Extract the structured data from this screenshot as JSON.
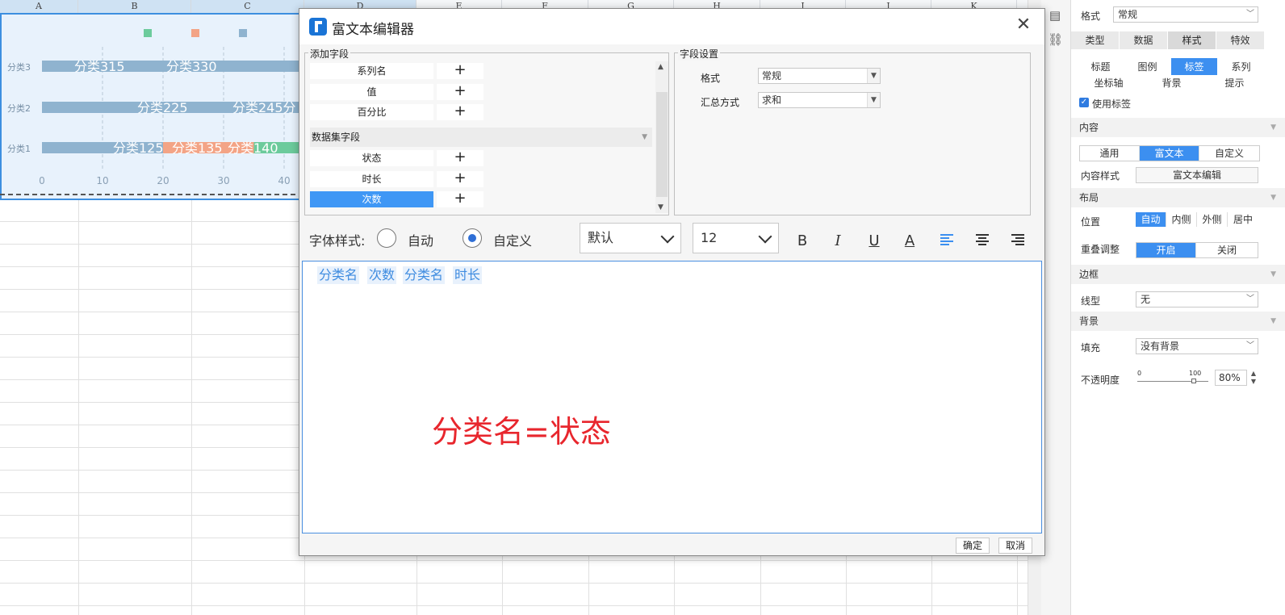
{
  "sheet": {
    "columns": [
      "A",
      "B",
      "C",
      "D",
      "E",
      "F",
      "G",
      "H",
      "I",
      "J",
      "K"
    ]
  },
  "chart_data": {
    "type": "bar",
    "orientation": "horizontal",
    "stacked": true,
    "categories": [
      "分类3",
      "分类2",
      "分类1"
    ],
    "series": [
      {
        "values": [
          50,
          60,
          20
        ],
        "color": "#8fb3cf"
      },
      {
        "values": [
          0,
          0,
          15
        ],
        "color": "#f3a486"
      },
      {
        "values": [
          0,
          0,
          15
        ],
        "color": "#6ccb9c"
      }
    ],
    "data_labels": [
      {
        "category": "分类3",
        "texts": [
          "分类315",
          "分类330"
        ]
      },
      {
        "category": "分类2",
        "texts": [
          "分类225",
          "分类245分"
        ]
      },
      {
        "category": "分类1",
        "texts": [
          "分类125",
          "分类135",
          "分类140"
        ]
      }
    ],
    "x_ticks": [
      "0",
      "10",
      "20",
      "30",
      "40"
    ],
    "xlim": [
      0,
      40
    ],
    "legend_position": "top",
    "legend_colors": [
      "#6ccb9c",
      "#f3a486",
      "#8fb3cf"
    ],
    "grid": true
  },
  "dialog": {
    "title": "富文本编辑器",
    "close_symbol": "✕",
    "add_fields_legend": "添加字段",
    "fields": [
      {
        "label": "系列名",
        "add": "+"
      },
      {
        "label": "值",
        "add": "+"
      },
      {
        "label": "百分比",
        "add": "+"
      }
    ],
    "dataset_header": "数据集字段",
    "dataset_fields": [
      {
        "label": "状态",
        "add": "+"
      },
      {
        "label": "时长",
        "add": "+"
      },
      {
        "label": "次数",
        "add": "+",
        "selected": true
      }
    ],
    "field_settings_legend": "字段设置",
    "settings": {
      "format_label": "格式",
      "format_value": "常规",
      "summary_label": "汇总方式",
      "summary_value": "求和"
    },
    "toolbar": {
      "font_style_label": "字体样式:",
      "radio_auto": "自动",
      "radio_custom": "自定义",
      "font_family": "默认",
      "font_size": "12",
      "bold": "B",
      "italic": "I",
      "underline": "U",
      "font_color": "A"
    },
    "editor": {
      "tags": [
        "分类名",
        "次数",
        "分类名",
        "时长"
      ],
      "red_note": "分类名=状态"
    },
    "ok": "确定",
    "cancel": "取消"
  },
  "panel": {
    "format_label": "格式",
    "format_value": "常规",
    "main_tabs": [
      "类型",
      "数据",
      "样式",
      "特效"
    ],
    "sub_tabs_row1": [
      "标题",
      "图例",
      "标签",
      "系列"
    ],
    "sub_tabs_row2": [
      "坐标轴",
      "背景",
      "提示"
    ],
    "use_label": "使用标签",
    "content_header": "内容",
    "content_modes": [
      "通用",
      "富文本",
      "自定义"
    ],
    "content_style_label": "内容样式",
    "content_style_button": "富文本编辑",
    "layout_header": "布局",
    "position_label": "位置",
    "positions": [
      "自动",
      "内侧",
      "外侧",
      "居中"
    ],
    "overlap_label": "重叠调整",
    "overlap_options": [
      "开启",
      "关闭"
    ],
    "border_header": "边框",
    "line_label": "线型",
    "line_value": "无",
    "bg_header": "背景",
    "fill_label": "填充",
    "fill_value": "没有背景",
    "opacity_label": "不透明度",
    "opacity_min": "0",
    "opacity_max": "100",
    "opacity_value": "80%",
    "opacity_fraction": 0.8
  }
}
